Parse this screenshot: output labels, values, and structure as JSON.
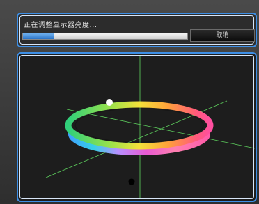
{
  "status": {
    "text": "正在调整显示器亮度...",
    "progress_percent": 19
  },
  "buttons": {
    "cancel_label": "取消"
  },
  "colors": {
    "accent_border": "#3d8fe6",
    "axis_line": "#5fd35f",
    "background": "#1d1d1d"
  }
}
